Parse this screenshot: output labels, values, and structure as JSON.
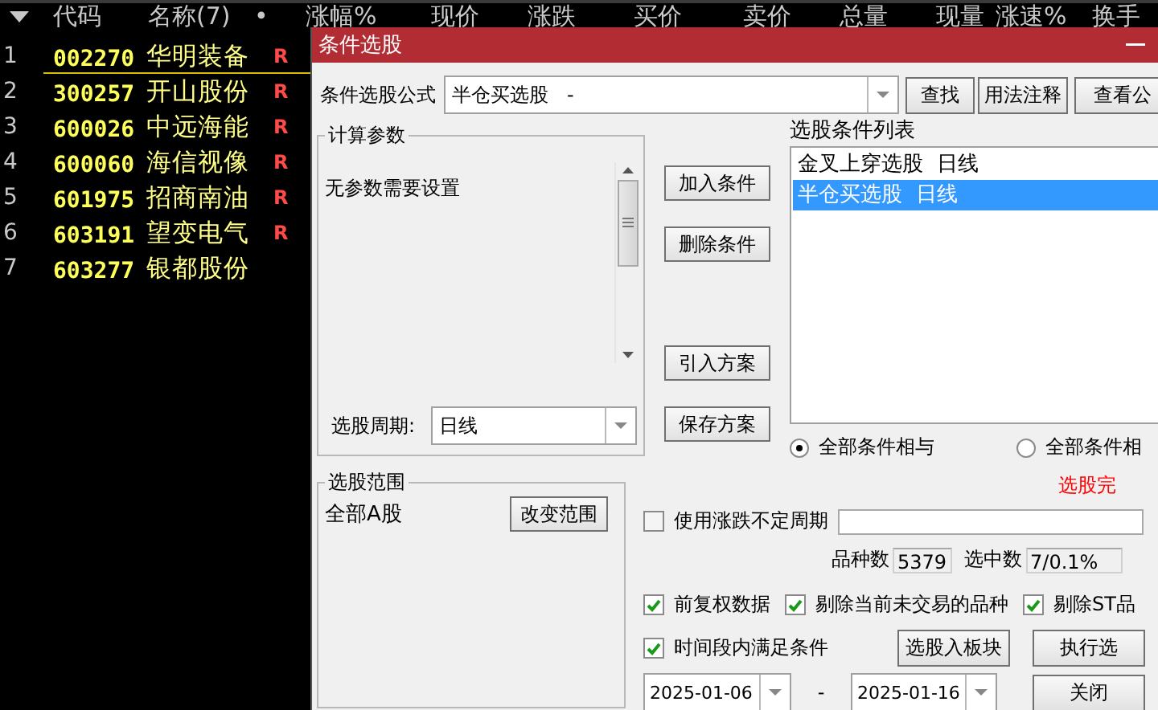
{
  "table": {
    "columns": [
      "代码",
      "名称(7)",
      "•",
      "涨幅%",
      "现价",
      "涨跌",
      "买价",
      "卖价",
      "总量",
      "现量",
      "涨速%",
      "换手"
    ],
    "rows": [
      {
        "index": "1",
        "code": "002270",
        "name": "华明装备",
        "mark": "R",
        "selected": true
      },
      {
        "index": "2",
        "code": "300257",
        "name": "开山股份",
        "mark": "R",
        "selected": false
      },
      {
        "index": "3",
        "code": "600026",
        "name": "中远海能",
        "mark": "R",
        "selected": false
      },
      {
        "index": "4",
        "code": "600060",
        "name": "海信视像",
        "mark": "R",
        "selected": false
      },
      {
        "index": "5",
        "code": "601975",
        "name": "招商南油",
        "mark": "R",
        "selected": false
      },
      {
        "index": "6",
        "code": "603191",
        "name": "望变电气",
        "mark": "R",
        "selected": false
      },
      {
        "index": "7",
        "code": "603277",
        "name": "银都股份",
        "selected": false
      }
    ]
  },
  "dialog": {
    "title": "条件选股",
    "formula_label": "条件选股公式",
    "formula_value": "半仓买选股   -",
    "top_buttons": [
      "查找",
      "用法注释",
      "查看公"
    ],
    "params_group": {
      "title": "计算参数",
      "message": "无参数需要设置",
      "period_label": "选股周期:",
      "period_value": "日线"
    },
    "action_buttons": [
      "加入条件",
      "删除条件",
      "引入方案",
      "保存方案"
    ],
    "condition_list": {
      "title": "选股条件列表",
      "items": [
        {
          "label": "金叉上穿选股  日线",
          "selected": false
        },
        {
          "label": "半仓买选股  日线",
          "selected": true
        }
      ]
    },
    "combine_options": [
      {
        "label": "全部条件相与",
        "selected": true
      },
      {
        "label": "全部条件相",
        "selected": false
      }
    ],
    "status": "选股完",
    "range_group": {
      "title": "选股范围",
      "value": "全部A股",
      "button": "改变范围"
    },
    "variable_period": {
      "label": "使用涨跌不定周期",
      "checked": false
    },
    "count_label": "品种数",
    "count_value": "5379",
    "picked_label": "选中数",
    "picked_value": "7/0.1%",
    "options": [
      {
        "label": "前复权数据",
        "checked": true
      },
      {
        "label": "剔除当前未交易的品种",
        "checked": true
      },
      {
        "label": "剔除ST品",
        "checked": true
      }
    ],
    "period_option": {
      "label": "时间段内满足条件",
      "checked": true
    },
    "to_block_button": "选股入板块",
    "run_button": "执行选",
    "date_from": "2025-01-06",
    "date_separator": "-",
    "date_to": "2025-01-16",
    "close_button": "关闭"
  }
}
